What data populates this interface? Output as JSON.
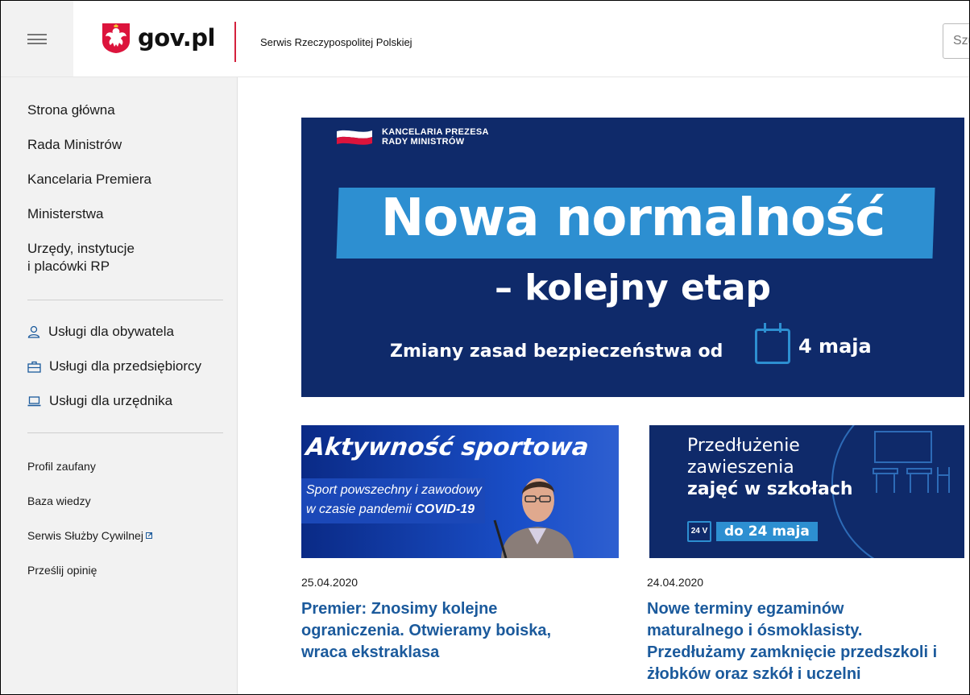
{
  "header": {
    "logo_text": "gov.pl",
    "tagline": "Serwis Rzeczypospolitej Polskiej",
    "search_placeholder": "Szukaj"
  },
  "sidebar": {
    "main_items": [
      {
        "label": "Strona główna"
      },
      {
        "label": "Rada Ministrów"
      },
      {
        "label": "Kancelaria Premiera"
      },
      {
        "label": "Ministerstwa"
      },
      {
        "label_line1": "Urzędy, instytucje",
        "label_line2": "i placówki RP"
      }
    ],
    "services": [
      {
        "label": "Usługi dla obywatela",
        "icon": "person-icon"
      },
      {
        "label": "Usługi dla przedsiębiorcy",
        "icon": "briefcase-icon"
      },
      {
        "label": "Usługi dla urzędnika",
        "icon": "laptop-icon"
      }
    ],
    "links": [
      {
        "label": "Profil zaufany"
      },
      {
        "label": "Baza wiedzy"
      },
      {
        "label": "Serwis Służby Cywilnej",
        "external": true
      },
      {
        "label": "Prześlij opinię"
      }
    ]
  },
  "hero": {
    "org_line1": "KANCELARIA PREZESA",
    "org_line2": "RADY MINISTRÓW",
    "title": "Nowa normalność",
    "subtitle": "– kolejny etap",
    "note": "Zmiany zasad bezpieczeństwa od",
    "date": "4 maja",
    "colors": {
      "background": "#0f2a6a",
      "accent": "#2d8fd1"
    }
  },
  "articles": [
    {
      "image_title": "Aktywność sportowa",
      "image_line1": "Sport powszechny i zawodowy",
      "image_line2_prefix": "w czasie pandemii",
      "image_line2_bold": "COVID-19",
      "date": "25.04.2020",
      "headline_lines": [
        "Premier: Znosimy kolejne",
        "ograniczenia. Otwieramy boiska,",
        "wraca ekstraklasa"
      ]
    },
    {
      "image_line1": "Przedłużenie",
      "image_line2": "zawieszenia",
      "image_line3": "zajęć w szkołach",
      "image_cal": "24 V",
      "image_pill": "do 24 maja",
      "date": "24.04.2020",
      "headline_lines": [
        "Nowe terminy egzaminów",
        "maturalnego i ósmoklasisty.",
        "Przedłużamy zamknięcie przedszkoli i",
        "żłobków oraz szkół i uczelni"
      ]
    }
  ]
}
